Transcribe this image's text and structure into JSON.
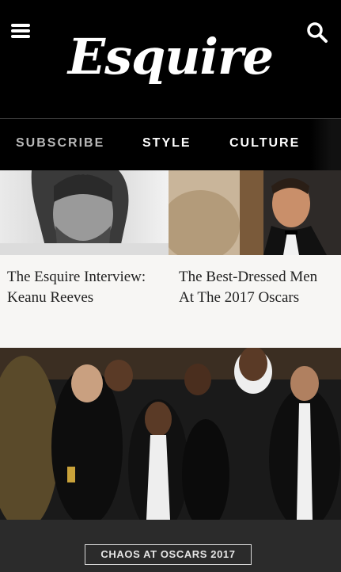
{
  "header": {
    "logo": "Esquire",
    "menu_icon": "menu-icon",
    "search_icon": "search-icon"
  },
  "nav": {
    "items": [
      {
        "label": "SUBSCRIBE"
      },
      {
        "label": "STYLE"
      },
      {
        "label": "CULTURE"
      }
    ]
  },
  "cards": [
    {
      "title": "The Esquire Interview: Keanu Reeves"
    },
    {
      "title": "The Best-Dressed Men At The 2017 Oscars"
    }
  ],
  "hero": {
    "tag": "CHAOS AT OSCARS 2017"
  }
}
